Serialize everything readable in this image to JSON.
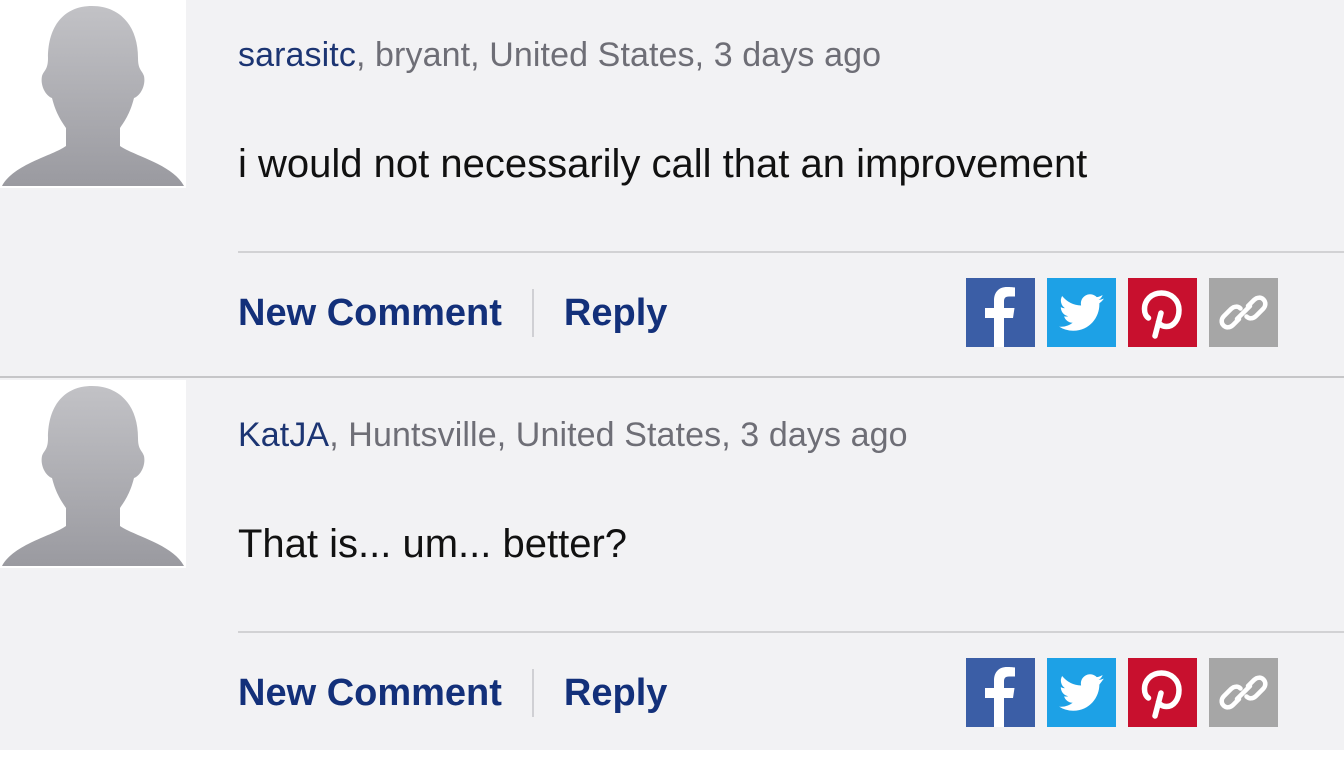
{
  "colors": {
    "page_bg": "#f2f2f4",
    "username": "#1c3573",
    "meta_text": "#6e6e76",
    "action_link": "#13307a",
    "facebook": "#3b5ea6",
    "twitter": "#1da1e6",
    "pinterest": "#c8102e",
    "link": "#a6a6a6"
  },
  "comments": [
    {
      "username": "sarasitc",
      "location": ", bryant, United States, 3 days ago",
      "text": "i would not necessarily call that an improvement",
      "actions": {
        "new_comment": "New Comment",
        "reply": "Reply"
      },
      "share_icons": [
        "facebook-icon",
        "twitter-icon",
        "pinterest-icon",
        "link-icon"
      ]
    },
    {
      "username": "KatJA",
      "location": ", Huntsville, United States, 3 days ago",
      "text": "That is... um... better?",
      "actions": {
        "new_comment": "New Comment",
        "reply": "Reply"
      },
      "share_icons": [
        "facebook-icon",
        "twitter-icon",
        "pinterest-icon",
        "link-icon"
      ]
    }
  ]
}
